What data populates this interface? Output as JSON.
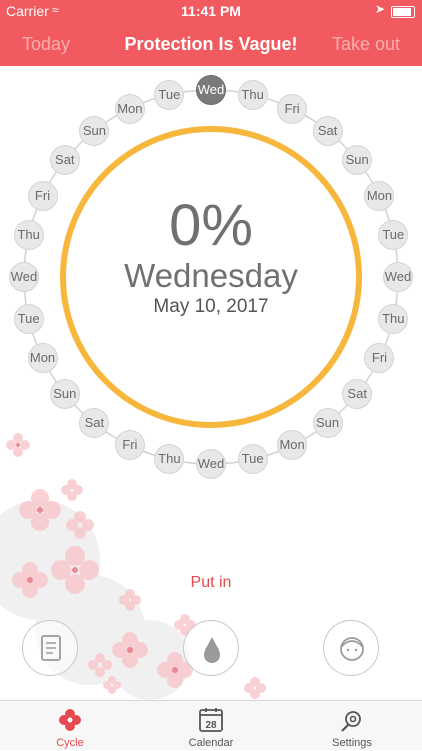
{
  "status_bar": {
    "carrier": "Carrier",
    "time": "11:41 PM"
  },
  "nav": {
    "left": "Today",
    "title": "Protection Is Vague!",
    "right": "Take out"
  },
  "ring_days": [
    "Wed",
    "Thu",
    "Fri",
    "Sat",
    "Sun",
    "Mon",
    "Tue",
    "Wed",
    "Thu",
    "Fri",
    "Sat",
    "Sun",
    "Mon",
    "Tue",
    "Wed",
    "Thu",
    "Fri",
    "Sat",
    "Sun",
    "Mon",
    "Tue",
    "Wed",
    "Thu",
    "Fri",
    "Sat",
    "Sun",
    "Mon",
    "Tue"
  ],
  "current_day_index": 0,
  "progress_ring_color": "#f6b73c",
  "center": {
    "percent": "0%",
    "day": "Wednesday",
    "date": "May 10, 2017"
  },
  "put_in_label": "Put in",
  "actions": [
    {
      "icon": "document-icon"
    },
    {
      "icon": "drop-icon"
    },
    {
      "icon": "face-icon"
    }
  ],
  "tabs": [
    {
      "label": "Cycle",
      "icon": "flower-icon",
      "active": true
    },
    {
      "label": "Calendar",
      "icon": "calendar-icon",
      "day": "28"
    },
    {
      "label": "Settings",
      "icon": "settings-icon"
    }
  ],
  "colors": {
    "accent": "#f15a5e",
    "tab_active": "#e44a50"
  }
}
